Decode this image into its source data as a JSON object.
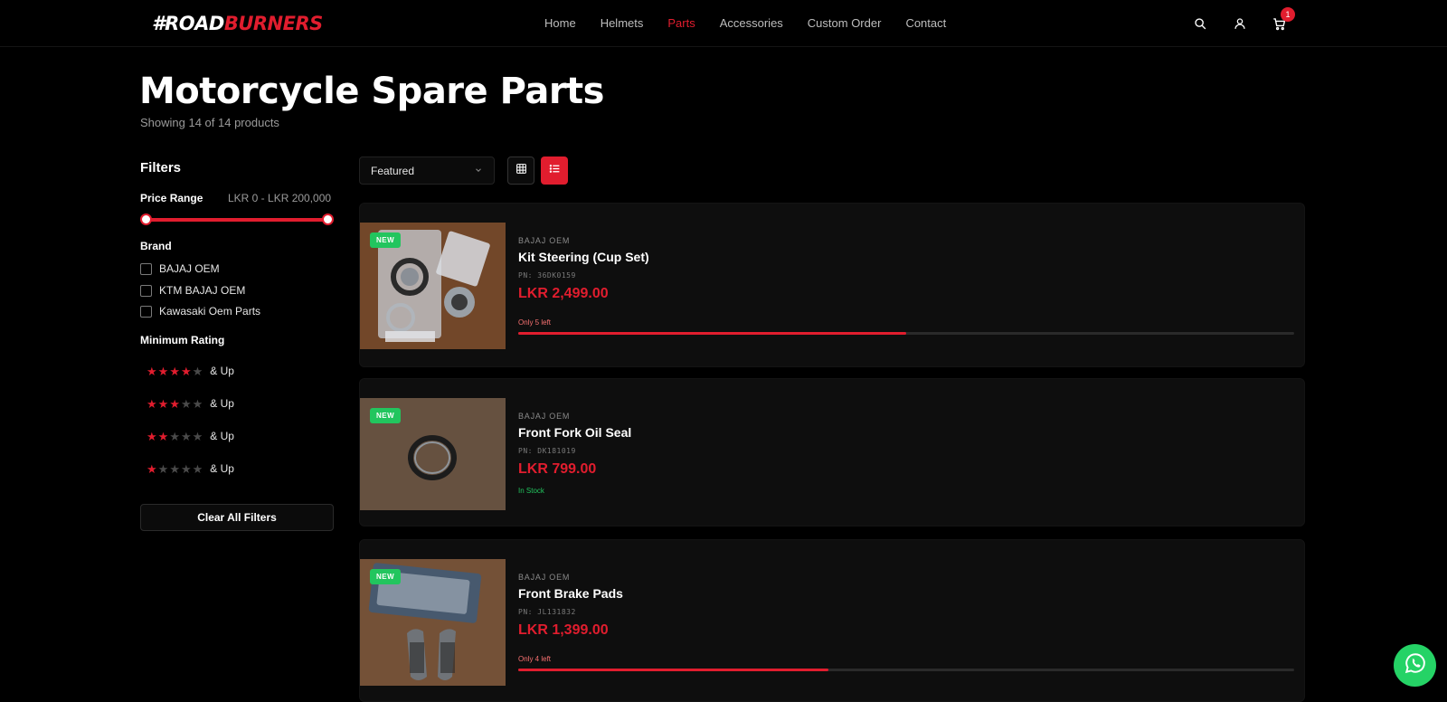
{
  "header": {
    "logo_prefix": "#ROAD",
    "logo_suffix": "BURNERS",
    "nav": [
      "Home",
      "Helmets",
      "Parts",
      "Accessories",
      "Custom Order",
      "Contact"
    ],
    "active_nav": "Parts",
    "icons": [
      "search-icon",
      "user-icon",
      "cart-icon"
    ],
    "cart_count": "1"
  },
  "page": {
    "title": "Motorcycle Spare Parts",
    "subtitle": "Showing 14 of 14 products"
  },
  "filters": {
    "title": "Filters",
    "price_label": "Price Range",
    "price_range": "LKR 0 - LKR 200,000",
    "brand_label": "Brand",
    "brands": [
      "BAJAJ OEM",
      "KTM BAJAJ OEM",
      "Kawasaki Oem Parts"
    ],
    "rating_label": "Minimum Rating",
    "ratings": [
      {
        "stars": 4,
        "label": "& Up"
      },
      {
        "stars": 3,
        "label": "& Up"
      },
      {
        "stars": 2,
        "label": "& Up"
      },
      {
        "stars": 1,
        "label": "& Up"
      }
    ],
    "clear_label": "Clear All Filters"
  },
  "toolbar": {
    "sort_value": "Featured",
    "view_active": "list"
  },
  "products": [
    {
      "badge": "NEW",
      "brand": "BAJAJ OEM",
      "title": "Kit Steering (Cup Set)",
      "pn": "PN: 36DK0159",
      "price": "LKR 2,499.00",
      "stock_text": "Only 5 left",
      "stock_fraction": 0.5
    },
    {
      "badge": "NEW",
      "brand": "BAJAJ OEM",
      "title": "Front Fork Oil Seal",
      "pn": "PN: DK181019",
      "price": "LKR 799.00",
      "stock_text": "In Stock"
    },
    {
      "badge": "NEW",
      "brand": "BAJAJ OEM",
      "title": "Front Brake Pads",
      "pn": "PN: JL131832",
      "price": "LKR 1,399.00",
      "stock_text": "Only 4 left",
      "stock_fraction": 0.4
    }
  ],
  "colors": {
    "accent": "#e11d2e",
    "success": "#22c55e",
    "background": "#000000",
    "card": "#0e0e0e"
  }
}
